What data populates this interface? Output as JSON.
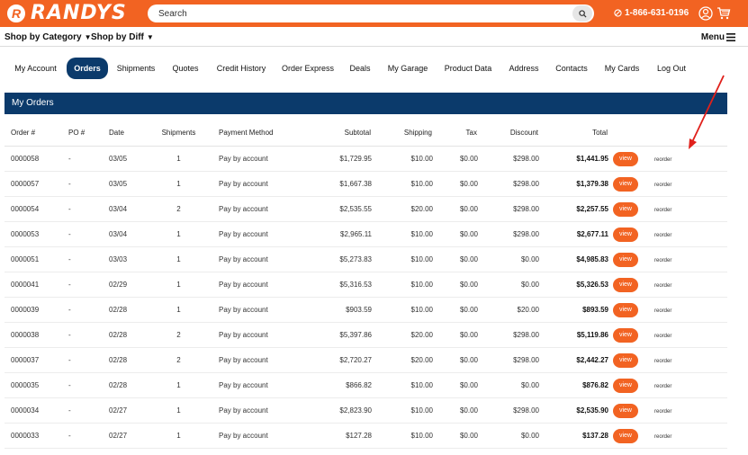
{
  "header": {
    "logo_text": "RANDYS",
    "logo_badge": "R",
    "search_placeholder": "Search",
    "phone": "1-866-631-0196"
  },
  "nav": {
    "category_label": "Shop by Category",
    "diff_label": "Shop by Diff",
    "menu_label": "Menu"
  },
  "tabs": [
    "My Account",
    "Orders",
    "Shipments",
    "Quotes",
    "Credit History",
    "Order Express",
    "Deals",
    "My Garage",
    "Product Data",
    "Address",
    "Contacts",
    "My Cards",
    "Log Out"
  ],
  "active_tab": "Orders",
  "panel": {
    "title": "My Orders"
  },
  "table": {
    "headers": {
      "order": "Order #",
      "po": "PO #",
      "date": "Date",
      "shipments": "Shipments",
      "payment": "Payment Method",
      "subtotal": "Subtotal",
      "shipping": "Shipping",
      "tax": "Tax",
      "discount": "Discount",
      "total": "Total"
    },
    "view_label": "view",
    "reorder_label": "reorder",
    "rows": [
      {
        "order": "0000058",
        "po": "-",
        "date": "03/05",
        "shipments": "1",
        "payment": "Pay by account",
        "subtotal": "$1,729.95",
        "shipping": "$10.00",
        "tax": "$0.00",
        "discount": "$298.00",
        "total": "$1,441.95"
      },
      {
        "order": "0000057",
        "po": "-",
        "date": "03/05",
        "shipments": "1",
        "payment": "Pay by account",
        "subtotal": "$1,667.38",
        "shipping": "$10.00",
        "tax": "$0.00",
        "discount": "$298.00",
        "total": "$1,379.38"
      },
      {
        "order": "0000054",
        "po": "-",
        "date": "03/04",
        "shipments": "2",
        "payment": "Pay by account",
        "subtotal": "$2,535.55",
        "shipping": "$20.00",
        "tax": "$0.00",
        "discount": "$298.00",
        "total": "$2,257.55"
      },
      {
        "order": "0000053",
        "po": "-",
        "date": "03/04",
        "shipments": "1",
        "payment": "Pay by account",
        "subtotal": "$2,965.11",
        "shipping": "$10.00",
        "tax": "$0.00",
        "discount": "$298.00",
        "total": "$2,677.11"
      },
      {
        "order": "0000051",
        "po": "-",
        "date": "03/03",
        "shipments": "1",
        "payment": "Pay by account",
        "subtotal": "$5,273.83",
        "shipping": "$10.00",
        "tax": "$0.00",
        "discount": "$0.00",
        "total": "$4,985.83"
      },
      {
        "order": "0000041",
        "po": "-",
        "date": "02/29",
        "shipments": "1",
        "payment": "Pay by account",
        "subtotal": "$5,316.53",
        "shipping": "$10.00",
        "tax": "$0.00",
        "discount": "$0.00",
        "total": "$5,326.53"
      },
      {
        "order": "0000039",
        "po": "-",
        "date": "02/28",
        "shipments": "1",
        "payment": "Pay by account",
        "subtotal": "$903.59",
        "shipping": "$10.00",
        "tax": "$0.00",
        "discount": "$20.00",
        "total": "$893.59"
      },
      {
        "order": "0000038",
        "po": "-",
        "date": "02/28",
        "shipments": "2",
        "payment": "Pay by account",
        "subtotal": "$5,397.86",
        "shipping": "$20.00",
        "tax": "$0.00",
        "discount": "$298.00",
        "total": "$5,119.86"
      },
      {
        "order": "0000037",
        "po": "-",
        "date": "02/28",
        "shipments": "2",
        "payment": "Pay by account",
        "subtotal": "$2,720.27",
        "shipping": "$20.00",
        "tax": "$0.00",
        "discount": "$298.00",
        "total": "$2,442.27"
      },
      {
        "order": "0000035",
        "po": "-",
        "date": "02/28",
        "shipments": "1",
        "payment": "Pay by account",
        "subtotal": "$866.82",
        "shipping": "$10.00",
        "tax": "$0.00",
        "discount": "$0.00",
        "total": "$876.82"
      },
      {
        "order": "0000034",
        "po": "-",
        "date": "02/27",
        "shipments": "1",
        "payment": "Pay by account",
        "subtotal": "$2,823.90",
        "shipping": "$10.00",
        "tax": "$0.00",
        "discount": "$298.00",
        "total": "$2,535.90"
      },
      {
        "order": "0000033",
        "po": "-",
        "date": "02/27",
        "shipments": "1",
        "payment": "Pay by account",
        "subtotal": "$127.28",
        "shipping": "$10.00",
        "tax": "$0.00",
        "discount": "$0.00",
        "total": "$137.28"
      }
    ]
  },
  "colors": {
    "brand": "#f26322",
    "navy": "#0b3a6b",
    "annotation": "#e0201b"
  },
  "icons": [
    "search-icon",
    "phone-icon",
    "user-icon",
    "cart-icon",
    "menu-icon",
    "caret-down-icon"
  ]
}
